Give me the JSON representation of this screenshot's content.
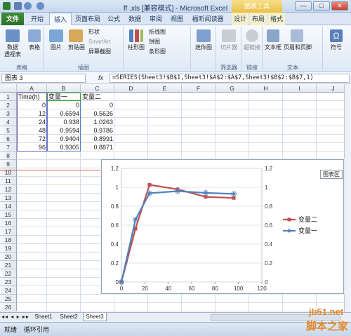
{
  "window": {
    "title": "ff .xls [兼容模式] - Microsoft Excel",
    "context_group": "图表工具",
    "controls": [
      "—",
      "□",
      "✕"
    ]
  },
  "ribbon_tabs": [
    "文件",
    "开始",
    "插入",
    "页面布局",
    "公式",
    "数据",
    "审阅",
    "视图",
    "福昕阅读器",
    "设计",
    "布局",
    "格式"
  ],
  "ribbon": {
    "pivot": "数据\n透视表",
    "table": "表格",
    "picture": "图片",
    "clipart": "剪贴画",
    "shapes": "形状",
    "smartart": "SmartArt",
    "screenshot": "屏幕截图",
    "column_chart": "柱形图",
    "line_chart": "折线图",
    "pie_chart": "饼图",
    "bar_chart": "条形图",
    "sparkline": "迷你图",
    "slicer": "切片器",
    "hyperlink": "超链接",
    "textbox": "文本框",
    "header_footer": "页眉和页脚",
    "symbol": "符号",
    "groups": {
      "tables": "表格",
      "illustrations": "插图",
      "filter": "筛选器",
      "links": "链接",
      "text": "文本"
    }
  },
  "namebox": "图表 3",
  "fx": "fx",
  "formula": "=SERIES(Sheet3!$B$1,Sheet3!$A$2:$A$7,Sheet3!$B$2:$B$7,1)",
  "columns": [
    "A",
    "B",
    "C",
    "D",
    "E",
    "F",
    "G",
    "H",
    "I",
    "J"
  ],
  "rows": [
    "1",
    "2",
    "3",
    "4",
    "5",
    "6",
    "7",
    "8",
    "9",
    "10",
    "11",
    "12",
    "13",
    "14",
    "15",
    "16",
    "17",
    "18",
    "19",
    "20",
    "21",
    "22",
    "23",
    "24",
    "25",
    "26"
  ],
  "table": {
    "headers": [
      "Time(h)",
      "变量一",
      "变量二"
    ],
    "data": [
      [
        "0",
        "0",
        "0"
      ],
      [
        "12",
        "0.6594",
        "0.5626"
      ],
      [
        "24",
        "0.938",
        "1.0263"
      ],
      [
        "48",
        "0.9594",
        "0.9786"
      ],
      [
        "72",
        "0.9404",
        "0.8991"
      ],
      [
        "96",
        "0.9305",
        "0.8871"
      ]
    ]
  },
  "chart_area_tip": "图表区",
  "chart_data": {
    "type": "line",
    "x": [
      0,
      12,
      24,
      48,
      72,
      96
    ],
    "series": [
      {
        "name": "变量二",
        "color": "#c0504d",
        "values": [
          0,
          0.5626,
          1.0263,
          0.9786,
          0.8991,
          0.8871
        ]
      },
      {
        "name": "变量一",
        "color": "#4f81bd",
        "values": [
          0,
          0.6594,
          0.938,
          0.9594,
          0.9404,
          0.9305
        ]
      }
    ],
    "xlim": [
      0,
      120
    ],
    "ylim": [
      0,
      1.2
    ],
    "xticks": [
      "0",
      "20",
      "40",
      "60",
      "80",
      "100",
      "120"
    ],
    "yticks": [
      "0",
      "0.2",
      "0.4",
      "0.6",
      "0.8",
      "1",
      "1.2"
    ],
    "secondary_yticks": [
      "0",
      "0.2",
      "0.4",
      "0.6",
      "0.8",
      "1",
      "1.2"
    ],
    "legend": "right"
  },
  "sheet_tabs": [
    "Sheet1",
    "Sheet2",
    "Sheet3"
  ],
  "status": {
    "ready": "就绪",
    "circular": "循环引用"
  },
  "watermark": {
    "site": "jb51.net",
    "brand": "脚本之家"
  }
}
